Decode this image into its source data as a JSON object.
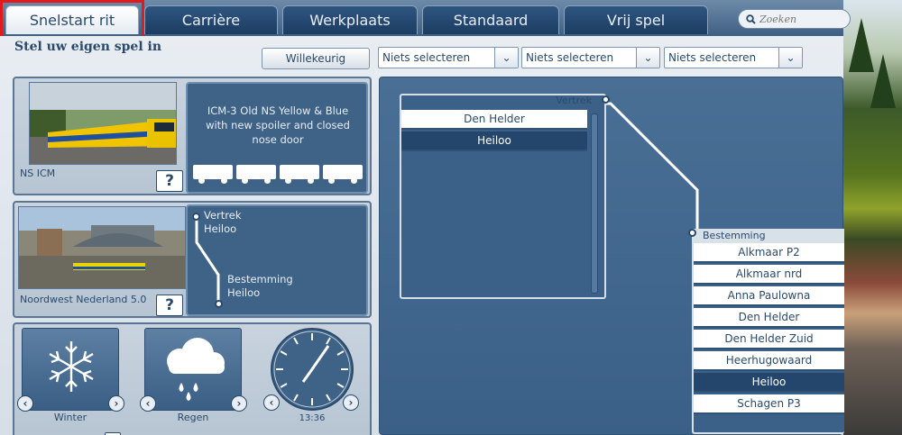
{
  "tabs": [
    {
      "label": "Snelstart rit",
      "active": true
    },
    {
      "label": "Carrière"
    },
    {
      "label": "Werkplaats"
    },
    {
      "label": "Standaard"
    },
    {
      "label": "Vrij spel"
    }
  ],
  "search": {
    "placeholder": "Zoeken"
  },
  "heading": "Stel uw eigen spel in",
  "random_button": "Willekeurig",
  "dropdowns": [
    "Niets selecteren",
    "Niets selecteren",
    "Niets selecteren"
  ],
  "train": {
    "name": "NS ICM",
    "description": "ICM-3 Old NS Yellow & Blue with new spoiler and closed nose door",
    "help": "?"
  },
  "route": {
    "name": "Noordwest Nederland 5.0",
    "help": "?",
    "departure_label": "Vertrek",
    "departure_station": "Heiloo",
    "destination_label": "Bestemming",
    "destination_station": "Heiloo"
  },
  "conditions": {
    "season": "Winter",
    "weather": "Regen",
    "time": "13:36"
  },
  "departure_list": {
    "header": "Vertrek",
    "items": [
      "Den Helder",
      "Heiloo"
    ],
    "selected": "Heiloo"
  },
  "destination_list": {
    "header": "Bestemming",
    "items": [
      "Alkmaar P2",
      "Alkmaar nrd",
      "Anna Paulowna",
      "Den Helder",
      "Den Helder Zuid",
      "Heerhugowaard",
      "Heiloo",
      "Schagen P3"
    ],
    "selected": "Heiloo"
  },
  "colors": {
    "accent": "#2a4a6c",
    "highlight_box": "#e3191c",
    "selected_row": "#24466c"
  }
}
